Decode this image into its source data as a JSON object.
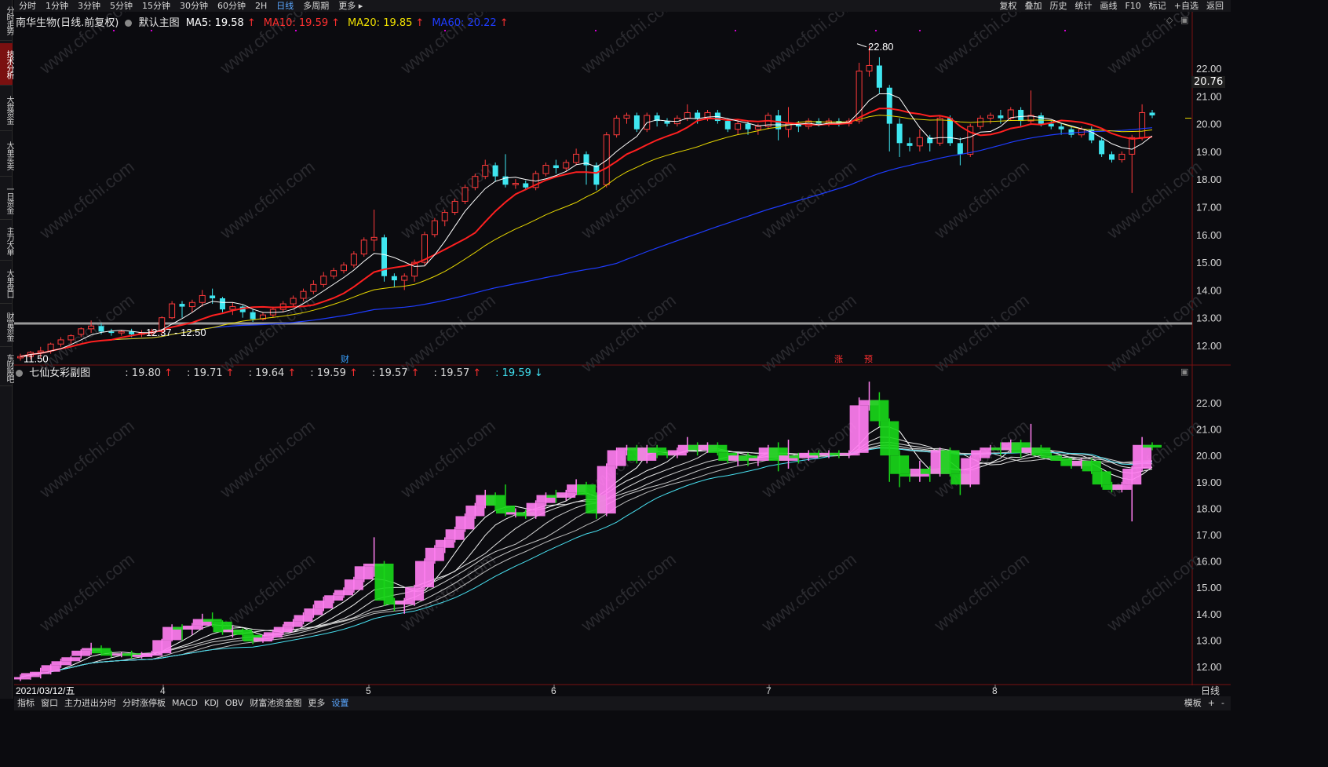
{
  "toolbar": {
    "periods": [
      "分时",
      "1分钟",
      "3分钟",
      "5分钟",
      "15分钟",
      "30分钟",
      "60分钟",
      "2H",
      "日线",
      "多周期",
      "更多 ▸"
    ],
    "active_period": "日线",
    "right_buttons": [
      "复权",
      "叠加",
      "历史",
      "统计",
      "画线",
      "F10",
      "标记",
      "+自选",
      "返回"
    ]
  },
  "side_tabs": [
    {
      "label": "分时走势",
      "active": false
    },
    {
      "label": "技术分析",
      "active": true
    },
    {
      "label": "大盘资金",
      "active": false
    },
    {
      "label": "大单买卖",
      "active": false
    },
    {
      "label": "一日资金",
      "active": false
    },
    {
      "label": "主力大单",
      "active": false
    },
    {
      "label": "大单盘口",
      "active": false
    },
    {
      "label": "财富资金",
      "active": false
    },
    {
      "label": "东财股吧",
      "active": false
    }
  ],
  "main_chart": {
    "title": "南华生物(日线.前复权)",
    "indicator_name": "默认主图",
    "ma": [
      {
        "label": "MA5: 19.58",
        "arrow": "↑",
        "color": "#ffffff"
      },
      {
        "label": "MA10: 19.59",
        "arrow": "↑",
        "color": "#ff3030"
      },
      {
        "label": "MA20: 19.85",
        "arrow": "↑",
        "color": "#f0e000"
      },
      {
        "label": "MA60: 20.22",
        "arrow": "↑",
        "color": "#1e3cff"
      }
    ],
    "high_label": "22.80",
    "low_label": "11.50",
    "range_label": "12.37 - 12.50",
    "current_price": "20.76",
    "y_ticks": [
      "22.00",
      "21.00",
      "20.00",
      "19.00",
      "18.00",
      "17.00",
      "16.00",
      "15.00",
      "14.00",
      "13.00",
      "12.00"
    ],
    "markers": [
      {
        "label": "财",
        "color": "#3aa0ff"
      },
      {
        "label": "涨",
        "color": "#ff3030"
      },
      {
        "label": "预",
        "color": "#ff3030"
      }
    ]
  },
  "sub_chart": {
    "title": "七仙女彩副图",
    "values": [
      {
        "label": ": 19.80",
        "arrow": "↑",
        "color": "#d8d8d8"
      },
      {
        "label": ": 19.71",
        "arrow": "↑",
        "color": "#d8d8d8"
      },
      {
        "label": ": 19.64",
        "arrow": "↑",
        "color": "#d8d8d8"
      },
      {
        "label": ": 19.59",
        "arrow": "↑",
        "color": "#d8d8d8"
      },
      {
        "label": ": 19.57",
        "arrow": "↑",
        "color": "#d8d8d8"
      },
      {
        "label": ": 19.57",
        "arrow": "↑",
        "color": "#d8d8d8"
      },
      {
        "label": ": 19.59",
        "arrow": "↓",
        "color": "#40e0f0"
      }
    ],
    "y_ticks": [
      "22.00",
      "21.00",
      "20.00",
      "19.00",
      "18.00",
      "17.00",
      "16.00",
      "15.00",
      "14.00",
      "13.00",
      "12.00"
    ]
  },
  "x_axis": {
    "start_date": "2021/03/12/五",
    "month_ticks": [
      "4",
      "5",
      "6",
      "7",
      "8"
    ],
    "period_label": "日线"
  },
  "bottom_tabs": [
    "指标",
    "窗口",
    "主力进出分时",
    "分时涨停板",
    "MACD",
    "KDJ",
    "OBV",
    "财富池资金图",
    "更多",
    "设置"
  ],
  "bottom_tabs_accent": "设置",
  "bottom_right": [
    "模板",
    "+",
    "-"
  ],
  "watermark": "www.cfchi.com",
  "chart_data": {
    "type": "candlestick",
    "y_range": [
      11.5,
      22.8
    ],
    "candles": [
      [
        11.55,
        11.6,
        11.45,
        11.7
      ],
      [
        11.6,
        11.75,
        11.5,
        11.8
      ],
      [
        11.75,
        11.8,
        11.55,
        11.95
      ],
      [
        11.8,
        12.05,
        11.7,
        12.1
      ],
      [
        12.05,
        12.2,
        11.95,
        12.3
      ],
      [
        12.2,
        12.35,
        12.05,
        12.4
      ],
      [
        12.4,
        12.6,
        12.3,
        12.65
      ],
      [
        12.6,
        12.7,
        12.45,
        12.9
      ],
      [
        12.7,
        12.5,
        12.4,
        12.8
      ],
      [
        12.5,
        12.45,
        12.35,
        12.6
      ],
      [
        12.45,
        12.5,
        12.35,
        12.55
      ],
      [
        12.5,
        12.4,
        12.3,
        12.6
      ],
      [
        12.4,
        12.45,
        12.3,
        12.55
      ],
      [
        12.45,
        12.5,
        12.35,
        12.6
      ],
      [
        12.5,
        13.0,
        12.4,
        13.05
      ],
      [
        13.0,
        13.5,
        12.95,
        13.6
      ],
      [
        13.5,
        13.4,
        13.0,
        13.6
      ],
      [
        13.4,
        13.55,
        13.2,
        13.65
      ],
      [
        13.55,
        13.8,
        13.4,
        14.0
      ],
      [
        13.8,
        13.7,
        13.5,
        14.05
      ],
      [
        13.7,
        13.3,
        13.2,
        13.75
      ],
      [
        13.3,
        13.4,
        13.1,
        13.55
      ],
      [
        13.4,
        13.2,
        13.0,
        13.45
      ],
      [
        13.2,
        12.95,
        12.85,
        13.3
      ],
      [
        12.95,
        13.1,
        12.9,
        13.2
      ],
      [
        13.1,
        13.3,
        13.0,
        13.4
      ],
      [
        13.3,
        13.5,
        13.2,
        13.6
      ],
      [
        13.5,
        13.7,
        13.4,
        13.8
      ],
      [
        13.7,
        13.95,
        13.6,
        14.05
      ],
      [
        13.95,
        14.2,
        13.85,
        14.35
      ],
      [
        14.2,
        14.5,
        14.1,
        14.65
      ],
      [
        14.5,
        14.7,
        14.4,
        14.8
      ],
      [
        14.7,
        14.9,
        14.6,
        15.0
      ],
      [
        14.9,
        15.3,
        14.8,
        15.4
      ],
      [
        15.3,
        15.8,
        15.2,
        15.9
      ],
      [
        15.8,
        15.9,
        15.4,
        16.9
      ],
      [
        15.9,
        14.5,
        14.3,
        16.0
      ],
      [
        14.5,
        14.35,
        14.1,
        14.6
      ],
      [
        14.35,
        14.5,
        14.0,
        14.6
      ],
      [
        14.5,
        15.0,
        14.3,
        15.1
      ],
      [
        15.0,
        16.0,
        14.9,
        16.1
      ],
      [
        16.0,
        16.5,
        15.9,
        16.6
      ],
      [
        16.5,
        16.8,
        16.3,
        16.9
      ],
      [
        16.8,
        17.2,
        16.7,
        17.3
      ],
      [
        17.2,
        17.7,
        17.1,
        17.8
      ],
      [
        17.7,
        18.1,
        17.6,
        18.2
      ],
      [
        18.1,
        18.5,
        18.0,
        18.7
      ],
      [
        18.5,
        18.1,
        17.9,
        18.6
      ],
      [
        18.1,
        17.8,
        17.7,
        18.9
      ],
      [
        17.8,
        17.85,
        17.65,
        18.0
      ],
      [
        17.85,
        17.7,
        17.6,
        17.95
      ],
      [
        17.7,
        18.2,
        17.6,
        18.3
      ],
      [
        18.2,
        18.5,
        18.1,
        18.6
      ],
      [
        18.5,
        18.4,
        18.2,
        18.7
      ],
      [
        18.4,
        18.6,
        18.3,
        18.7
      ],
      [
        18.6,
        18.9,
        18.5,
        19.1
      ],
      [
        18.9,
        18.5,
        17.8,
        19.0
      ],
      [
        18.5,
        17.8,
        17.6,
        18.6
      ],
      [
        17.8,
        19.6,
        17.7,
        19.7
      ],
      [
        19.6,
        20.2,
        19.5,
        20.3
      ],
      [
        20.2,
        20.3,
        20.0,
        20.4
      ],
      [
        20.3,
        19.8,
        19.7,
        20.4
      ],
      [
        19.8,
        20.3,
        19.7,
        20.4
      ],
      [
        20.3,
        20.1,
        19.9,
        20.4
      ],
      [
        20.1,
        20.0,
        19.9,
        20.2
      ],
      [
        20.0,
        20.2,
        19.9,
        20.3
      ],
      [
        20.2,
        20.4,
        20.1,
        20.7
      ],
      [
        20.4,
        20.2,
        20.0,
        20.5
      ],
      [
        20.2,
        20.4,
        20.1,
        20.5
      ],
      [
        20.4,
        20.1,
        20.0,
        20.5
      ],
      [
        20.1,
        19.8,
        19.7,
        20.2
      ],
      [
        19.8,
        20.0,
        19.6,
        20.1
      ],
      [
        20.0,
        19.8,
        19.6,
        20.1
      ],
      [
        19.8,
        19.9,
        19.6,
        20.0
      ],
      [
        19.9,
        20.3,
        19.8,
        20.4
      ],
      [
        20.3,
        19.8,
        19.4,
        20.5
      ],
      [
        19.8,
        20.0,
        19.5,
        20.6
      ],
      [
        20.0,
        19.9,
        19.7,
        20.1
      ],
      [
        19.9,
        20.1,
        19.8,
        20.2
      ],
      [
        20.1,
        20.0,
        19.9,
        20.2
      ],
      [
        20.0,
        20.1,
        19.9,
        20.2
      ],
      [
        20.1,
        20.0,
        19.9,
        20.2
      ],
      [
        20.0,
        20.1,
        19.9,
        20.2
      ],
      [
        20.1,
        21.9,
        20.0,
        22.2
      ],
      [
        21.9,
        22.1,
        21.7,
        22.8
      ],
      [
        22.1,
        21.3,
        21.1,
        22.4
      ],
      [
        21.3,
        20.0,
        19.0,
        21.4
      ],
      [
        20.0,
        19.3,
        18.8,
        20.2
      ],
      [
        19.3,
        19.2,
        19.0,
        19.5
      ],
      [
        19.2,
        19.5,
        19.0,
        19.8
      ],
      [
        19.5,
        19.3,
        19.0,
        19.6
      ],
      [
        19.3,
        20.2,
        19.2,
        20.3
      ],
      [
        20.2,
        19.3,
        19.2,
        20.3
      ],
      [
        19.3,
        18.9,
        18.5,
        19.5
      ],
      [
        18.9,
        19.9,
        18.8,
        20.0
      ],
      [
        19.9,
        20.2,
        19.8,
        20.3
      ],
      [
        20.2,
        20.3,
        20.0,
        20.4
      ],
      [
        20.3,
        20.2,
        20.0,
        20.5
      ],
      [
        20.2,
        20.5,
        20.1,
        20.6
      ],
      [
        20.5,
        20.1,
        19.9,
        20.6
      ],
      [
        20.1,
        20.3,
        20.0,
        21.2
      ],
      [
        20.3,
        20.0,
        19.9,
        20.4
      ],
      [
        20.0,
        19.9,
        19.8,
        20.1
      ],
      [
        19.9,
        19.8,
        19.6,
        20.0
      ],
      [
        19.8,
        19.6,
        19.5,
        19.9
      ],
      [
        19.6,
        19.8,
        19.5,
        19.9
      ],
      [
        19.8,
        19.4,
        19.3,
        19.9
      ],
      [
        19.4,
        18.9,
        18.8,
        19.5
      ],
      [
        18.9,
        18.7,
        18.6,
        19.0
      ],
      [
        18.7,
        18.9,
        18.6,
        19.0
      ],
      [
        18.9,
        19.5,
        17.5,
        19.6
      ],
      [
        19.5,
        20.4,
        19.4,
        20.7
      ],
      [
        20.4,
        20.3,
        20.2,
        20.5
      ]
    ]
  }
}
